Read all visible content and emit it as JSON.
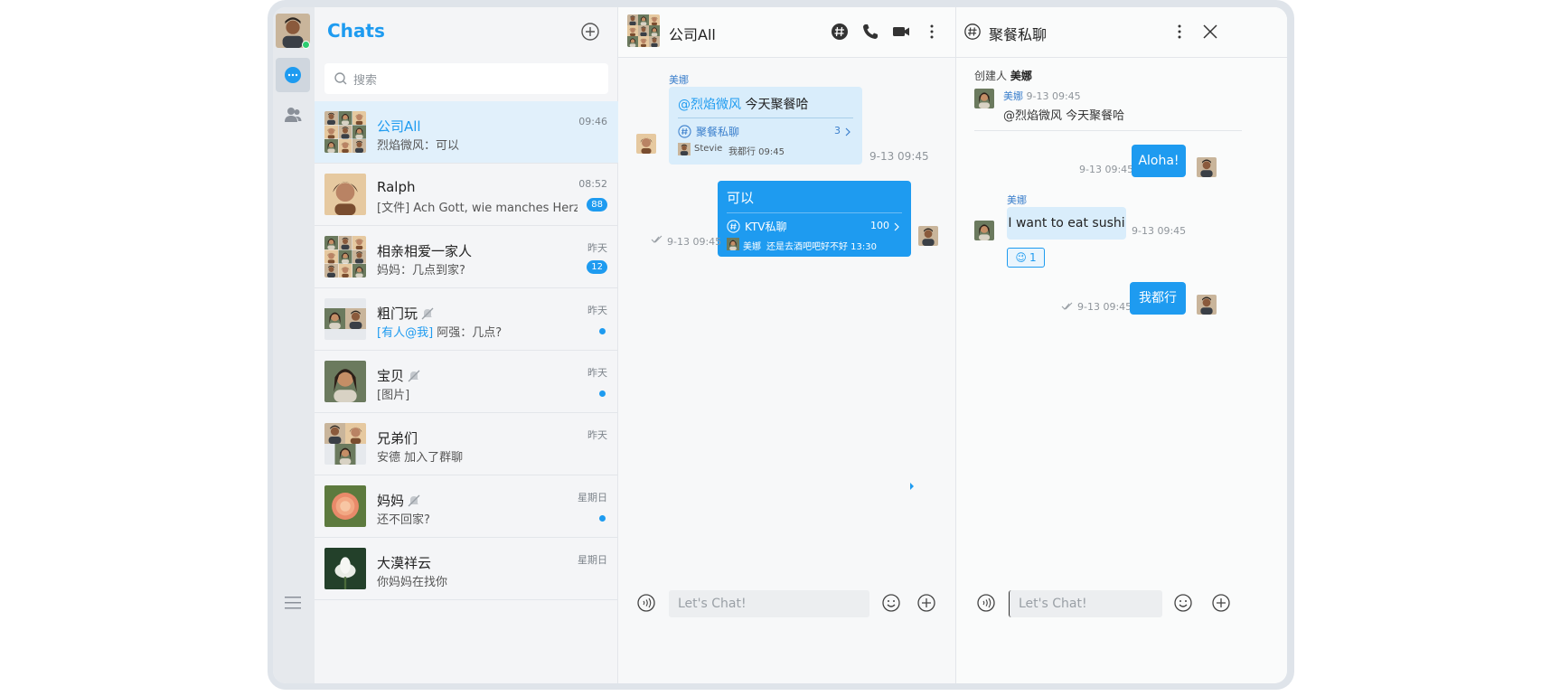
{
  "colors": {
    "accent": "#1e9bf0",
    "online": "#2ecc71",
    "bubble_in": "#d9edfb"
  },
  "nav": {
    "items": [
      "chats-icon",
      "contacts-icon",
      "menu-icon"
    ]
  },
  "list": {
    "title": "Chats",
    "search_placeholder": "搜索",
    "rows": [
      {
        "name": "公司All",
        "preview": "烈焰微风：可以",
        "time": "09:46"
      },
      {
        "name": "Ralph",
        "preview": "[文件] Ach Gott, wie manches Herz...",
        "time": "08:52",
        "badge": "88"
      },
      {
        "name": "相亲相爱一家人",
        "preview": "妈妈：几点到家?",
        "time": "昨天",
        "badge": "12"
      },
      {
        "name": "粗门玩",
        "mention": "[有人@我]",
        "preview": " 阿强：几点?",
        "time": "昨天"
      },
      {
        "name": "宝贝",
        "preview": "[图片]",
        "time": "昨天"
      },
      {
        "name": "兄弟们",
        "preview": "安德 加入了群聊",
        "time": "昨天"
      },
      {
        "name": "妈妈",
        "preview": "还不回家?",
        "time": "星期日"
      },
      {
        "name": "大漠祥云",
        "preview": "你妈妈在找你",
        "time": "星期日"
      }
    ]
  },
  "center": {
    "title": "公司All",
    "msg1": {
      "sender": "美娜",
      "mention": "@烈焰微风",
      "text": " 今天聚餐哈",
      "thread_name": "聚餐私聊",
      "thread_count": "3",
      "thread_last_user": "Stevie",
      "thread_last_text": "我都行 09:45",
      "time": "9-13 09:45"
    },
    "msg2": {
      "text": "可以",
      "thread_name": "KTV私聊",
      "thread_count": "100",
      "thread_last_user": "美娜",
      "thread_last_text": "还是去酒吧吧好不好 13:30",
      "time": "9-13 09:45"
    },
    "composer_placeholder": "Let's Chat!"
  },
  "thread": {
    "title": "聚餐私聊",
    "creator_label": "创建人",
    "creator_name": "美娜",
    "root_sender": "美娜",
    "root_time": "9-13 09:45",
    "root_text": "@烈焰微风 今天聚餐哈",
    "m1": {
      "text": "Aloha!",
      "time": "9-13 09:45"
    },
    "m2": {
      "sender": "美娜",
      "text": "I want to eat sushi",
      "time": "9-13 09:45",
      "reaction": "😉",
      "reaction_count": "1"
    },
    "m3": {
      "text": "我都行",
      "time": "9-13 09:45"
    },
    "composer_placeholder": "Let's Chat!"
  }
}
